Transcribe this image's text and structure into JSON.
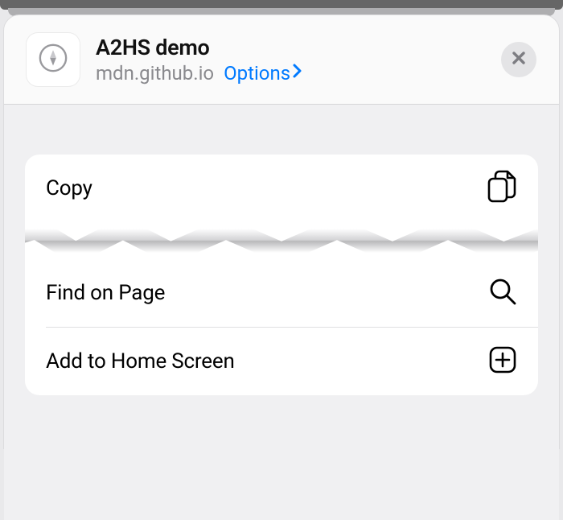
{
  "header": {
    "title": "A2HS demo",
    "host": "mdn.github.io",
    "options_label": "Options"
  },
  "menu": {
    "items": [
      {
        "label": "Copy",
        "icon": "copy-icon"
      },
      {
        "label": "Find on Page",
        "icon": "search-icon"
      },
      {
        "label": "Add to Home Screen",
        "icon": "add-icon"
      }
    ]
  }
}
